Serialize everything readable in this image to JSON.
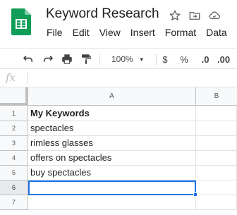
{
  "app": {
    "title": "Keyword Research",
    "logo_icon": "google-sheets-icon",
    "title_icons": [
      "star-icon",
      "move-to-folder-icon",
      "cloud-status-icon"
    ]
  },
  "menu": [
    "File",
    "Edit",
    "View",
    "Insert",
    "Format",
    "Data"
  ],
  "toolbar": {
    "zoom": "100%",
    "currency_label": "$",
    "percent_label": "%",
    "decrease_decimal_label": ".0",
    "increase_decimal_label": ".00",
    "icons": [
      "undo-icon",
      "redo-icon",
      "print-icon",
      "paint-format-icon"
    ]
  },
  "formula_bar": {
    "label": "fx",
    "value": ""
  },
  "sheet": {
    "columns": [
      "A",
      "B"
    ],
    "rows": [
      "1",
      "2",
      "3",
      "4",
      "5",
      "6",
      "7"
    ],
    "cells": [
      "My Keywords",
      "spectacles",
      "rimless glasses",
      "offers on spectacles",
      "buy spectacles",
      "",
      ""
    ],
    "selected_cell": "A6"
  },
  "colors": {
    "accent": "#1a73e8",
    "sheets_green": "#0f9d58"
  }
}
